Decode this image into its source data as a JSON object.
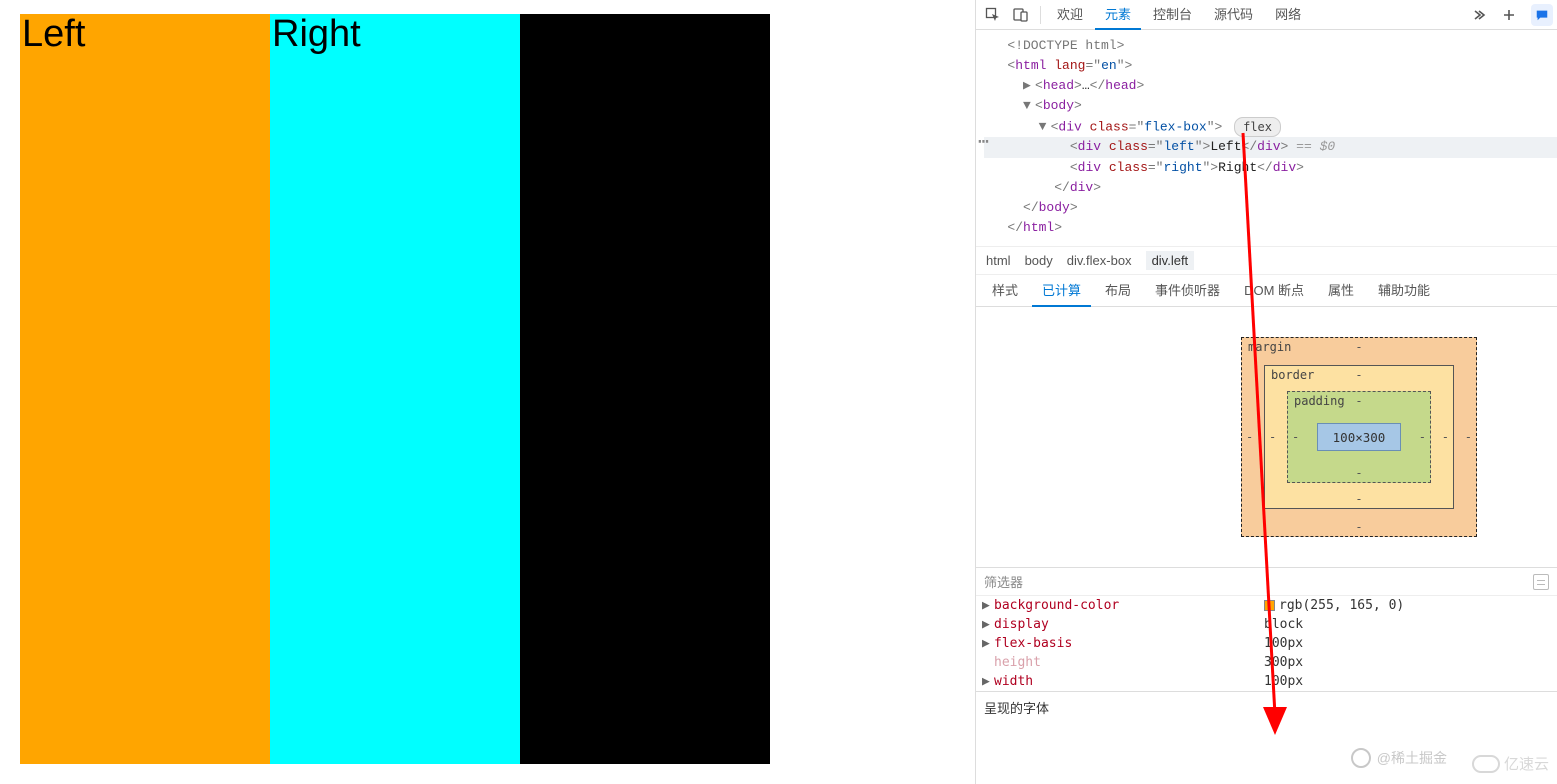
{
  "preview": {
    "left_text": "Left",
    "right_text": "Right",
    "left_bg": "#ffa500",
    "right_bg": "#00ffff",
    "container_bg": "#000000"
  },
  "devtools": {
    "tabs": {
      "welcome": "欢迎",
      "elements": "元素",
      "console": "控制台",
      "sources": "源代码",
      "network": "网络"
    },
    "dom": {
      "doctype": "<!DOCTYPE html>",
      "html_open": "<html lang=\"en\">",
      "head": "<head>…</head>",
      "body_open": "<body>",
      "flexbox_open": "<div class=\"flex-box\">",
      "flex_badge": "flex",
      "left_div": "<div class=\"left\">Left</div>",
      "left_suffix": " == $0",
      "right_div": "<div class=\"right\">Right</div>",
      "div_close": "</div>",
      "body_close": "</body>",
      "html_close": "</html>"
    },
    "breadcrumb": {
      "html": "html",
      "body": "body",
      "flexbox": "div.flex-box",
      "left": "div.left"
    },
    "subtabs": {
      "styles": "样式",
      "computed": "已计算",
      "layout": "布局",
      "listeners": "事件侦听器",
      "dom_breakpoints": "DOM 断点",
      "properties": "属性",
      "accessibility": "辅助功能"
    },
    "boxmodel": {
      "margin_label": "margin",
      "border_label": "border",
      "padding_label": "padding",
      "content": "100×300",
      "dash": "-"
    },
    "filter_label": "筛选器",
    "props": {
      "bgcolor_name": "background-color",
      "bgcolor_val": "rgb(255, 165, 0)",
      "bgcolor_swatch": "#ffa500",
      "display_name": "display",
      "display_val": "block",
      "flexbasis_name": "flex-basis",
      "flexbasis_val": "100px",
      "height_name": "height",
      "height_val": "300px",
      "width_name": "width",
      "width_val": "100px"
    },
    "footer": "呈现的字体"
  },
  "watermarks": {
    "juejin": "@稀土掘金",
    "yisu": "亿速云"
  }
}
